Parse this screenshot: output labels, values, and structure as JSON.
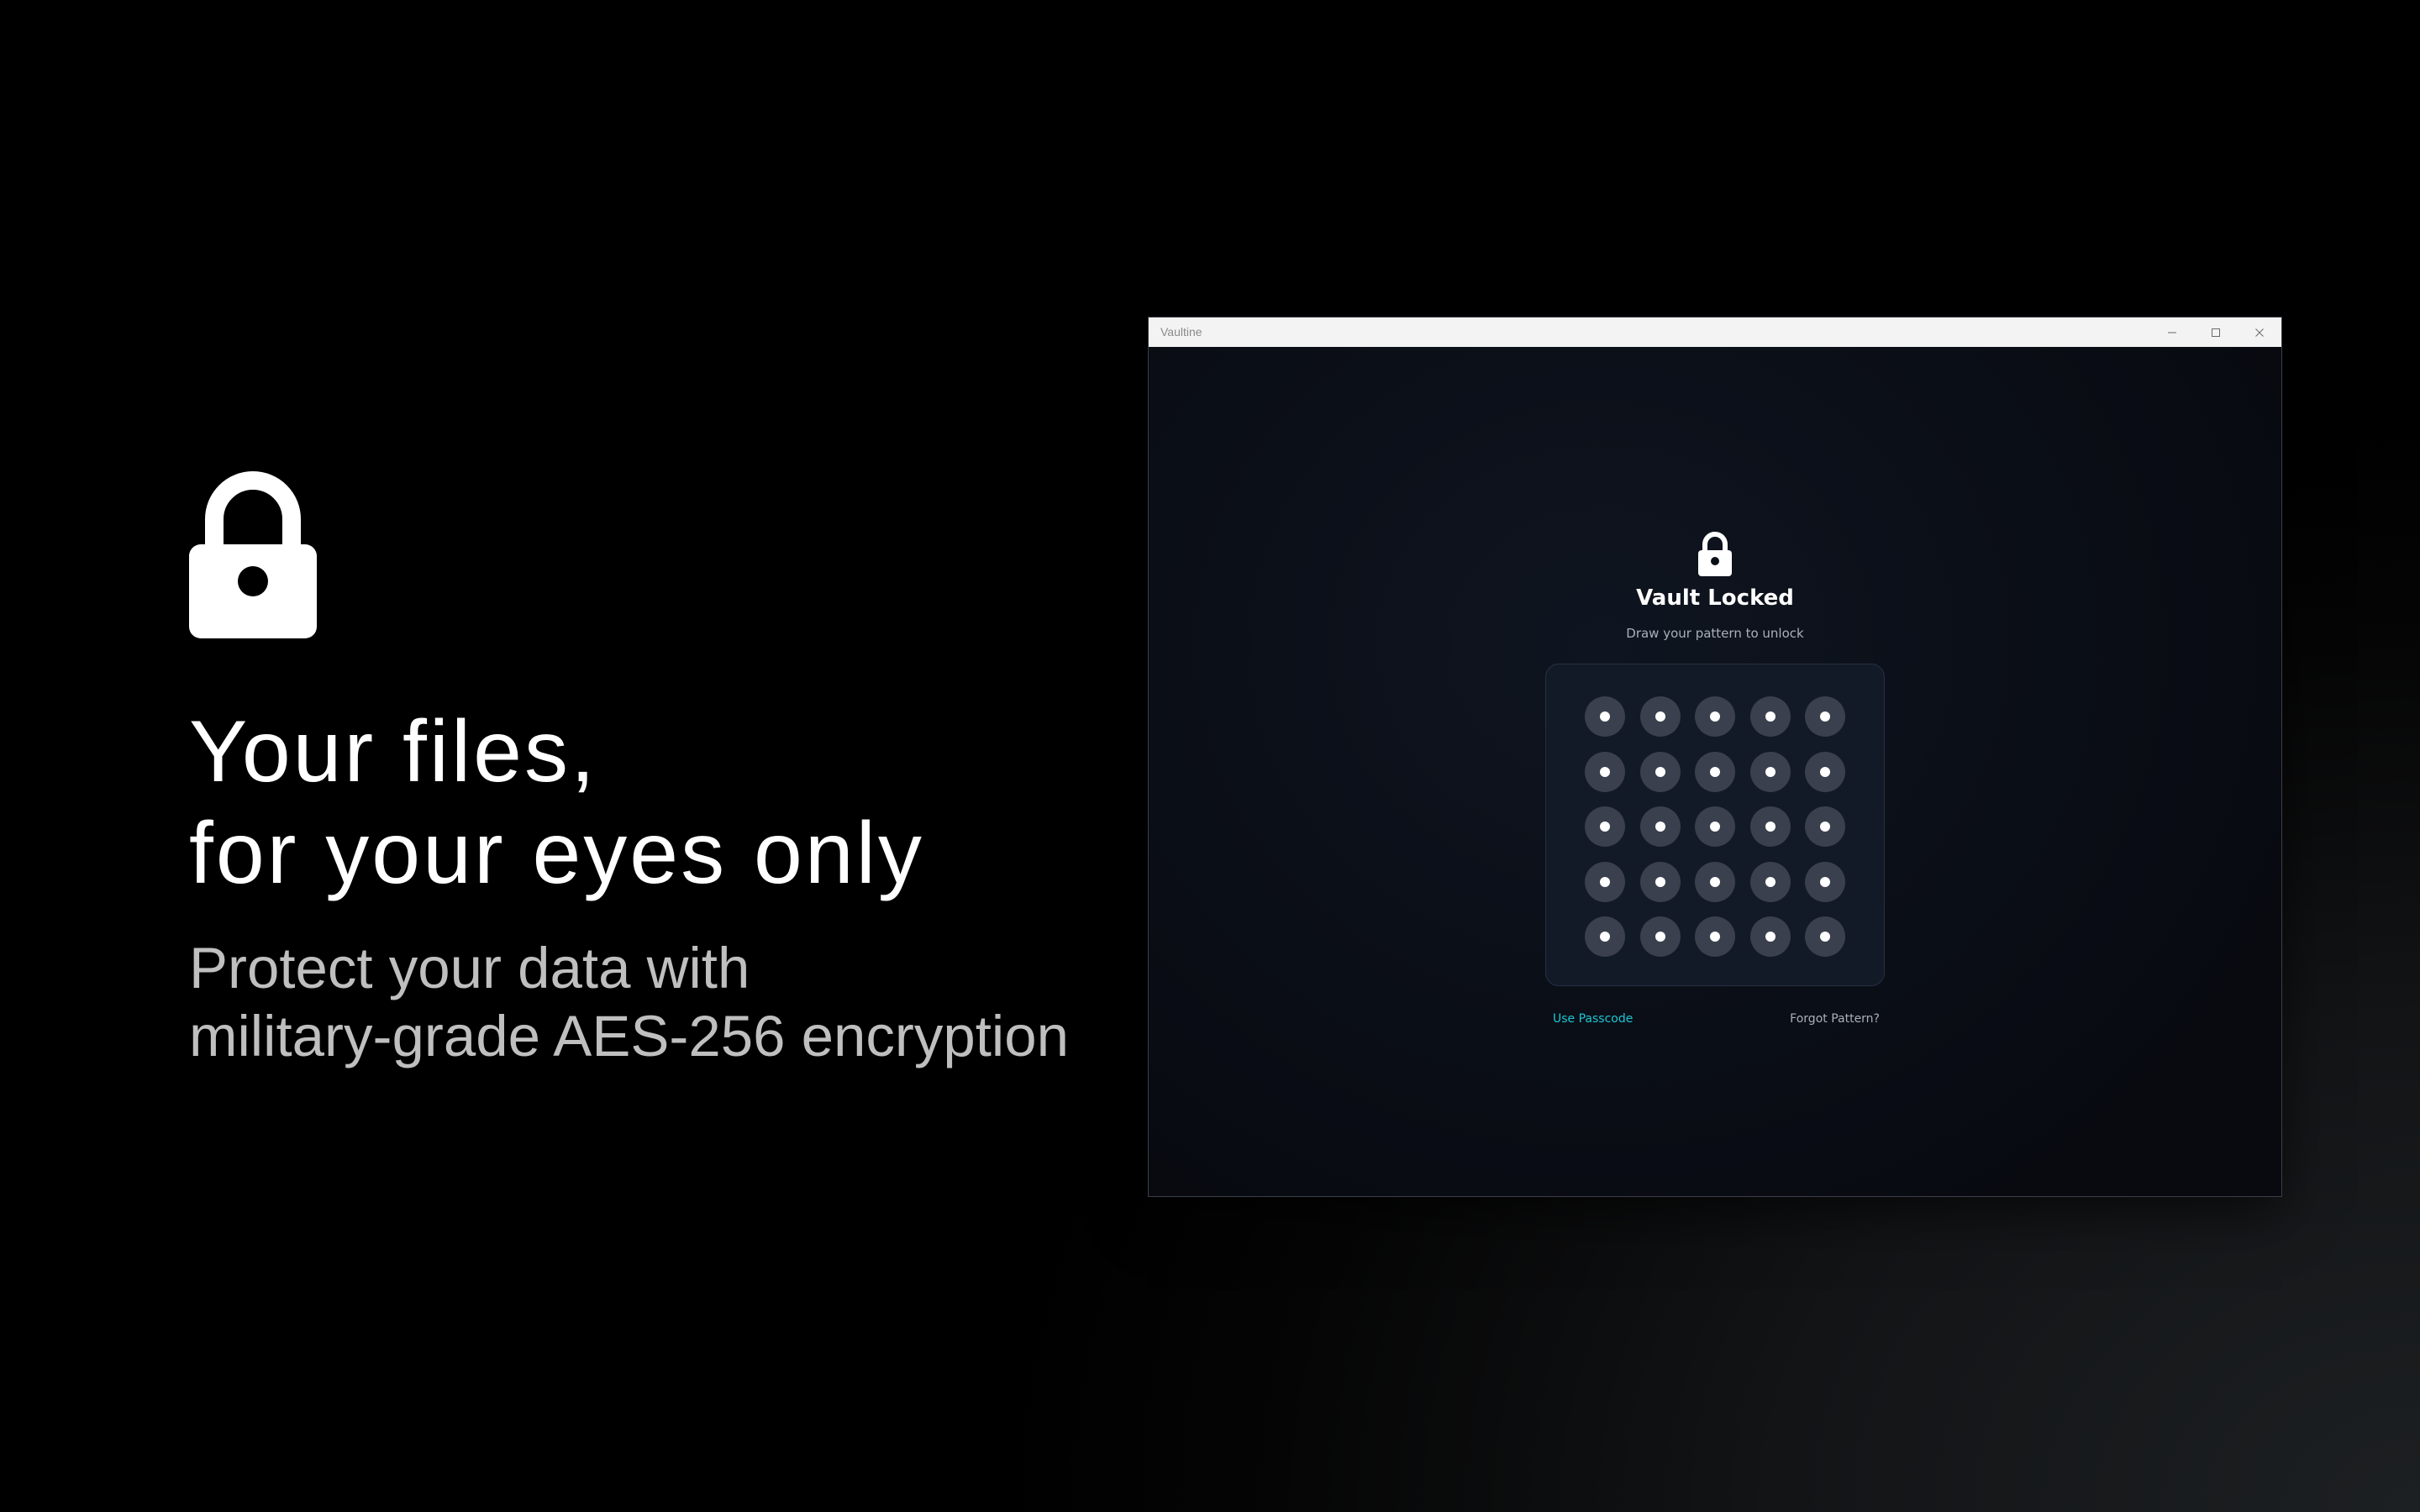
{
  "promo": {
    "icon": "lock-icon",
    "headline_lines": [
      "Your files,",
      "for your eyes only"
    ],
    "subline_lines": [
      "Protect your data with",
      "military-grade AES-256 encryption"
    ]
  },
  "window": {
    "title": "Vaultine",
    "controls": [
      "minimize-icon",
      "maximize-icon",
      "close-icon"
    ]
  },
  "lock_screen": {
    "icon": "lock-icon",
    "title": "Vault Locked",
    "subtitle": "Draw your pattern to unlock",
    "pattern_grid": {
      "rows": 5,
      "cols": 5
    },
    "use_passcode_label": "Use Passcode",
    "forgot_pattern_label": "Forgot Pattern?"
  },
  "colors": {
    "accent": "#19c8d4",
    "node": "#3a404d",
    "pad": "#131a27"
  }
}
